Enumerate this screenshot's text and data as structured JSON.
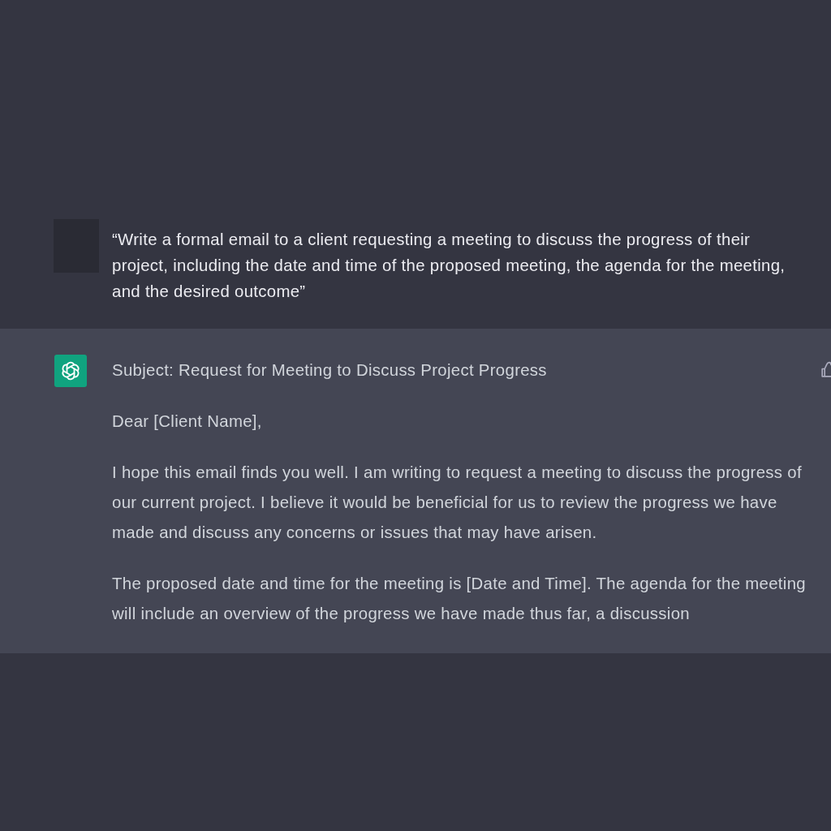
{
  "messages": [
    {
      "kind": "user",
      "paragraphs": [
        "“Write a formal email to a client requesting a meeting to discuss the progress of their project, including the date and time of the proposed meeting, the agenda for the meeting, and the desired outcome”"
      ]
    },
    {
      "kind": "assistant",
      "paragraphs": [
        "Subject: Request for Meeting to Discuss Project Progress",
        "Dear [Client Name],",
        "I hope this email finds you well. I am writing to request a meeting to discuss the progress of our current project. I believe it would be beneficial for us to review the progress we have made and discuss any concerns or issues that may have arisen.",
        "The proposed date and time for the meeting is [Date and Time]. The agenda for the meeting will include an overview of the progress we have made thus far, a discussion"
      ]
    }
  ]
}
